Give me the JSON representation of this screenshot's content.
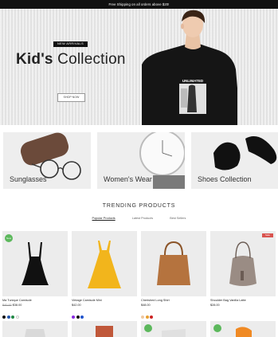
{
  "topbar": {
    "text": "Free Shipping on all orders above $20!"
  },
  "hero": {
    "badge": "NEW ARRIVALS",
    "title_strong": "Kid's",
    "title_rest": " Collection",
    "button": "SHOP NOW",
    "shirt_text": "UNLIMATED",
    "slides": 2,
    "active_slide": 2
  },
  "categories": [
    {
      "label": "Sunglasses"
    },
    {
      "label": "Women's Wear"
    },
    {
      "label": "Shoes Collection"
    }
  ],
  "trending": {
    "title": "TRENDING PRODUCTS",
    "tabs": [
      "Popular Products",
      "Latest Products",
      "Best Sellers"
    ],
    "active_tab": 0
  },
  "products": [
    {
      "name": "Ma Tunique Camisole",
      "price_old": "$40.00",
      "price": "$38.00",
      "badge": "New",
      "swatches": [
        "#111111",
        "#2255aa",
        "#228844",
        "#ffffff"
      ]
    },
    {
      "name": "Vintage Camisole Mini",
      "price": "$42.00",
      "swatches": [
        "#8a2be2",
        "#111111",
        "#2255cc"
      ]
    },
    {
      "name": "Cherished Long Shirt",
      "price": "$48.00",
      "swatches": [
        "#f0c8a0",
        "#e8a030",
        "#cc2222"
      ]
    },
    {
      "name": "Shoulder Bag Vanilla Latte",
      "price": "$28.00",
      "badge_sale": "Sale",
      "swatches": []
    }
  ],
  "colors": {
    "new_badge": "#5cb85c",
    "sale_badge": "#d9534f"
  }
}
